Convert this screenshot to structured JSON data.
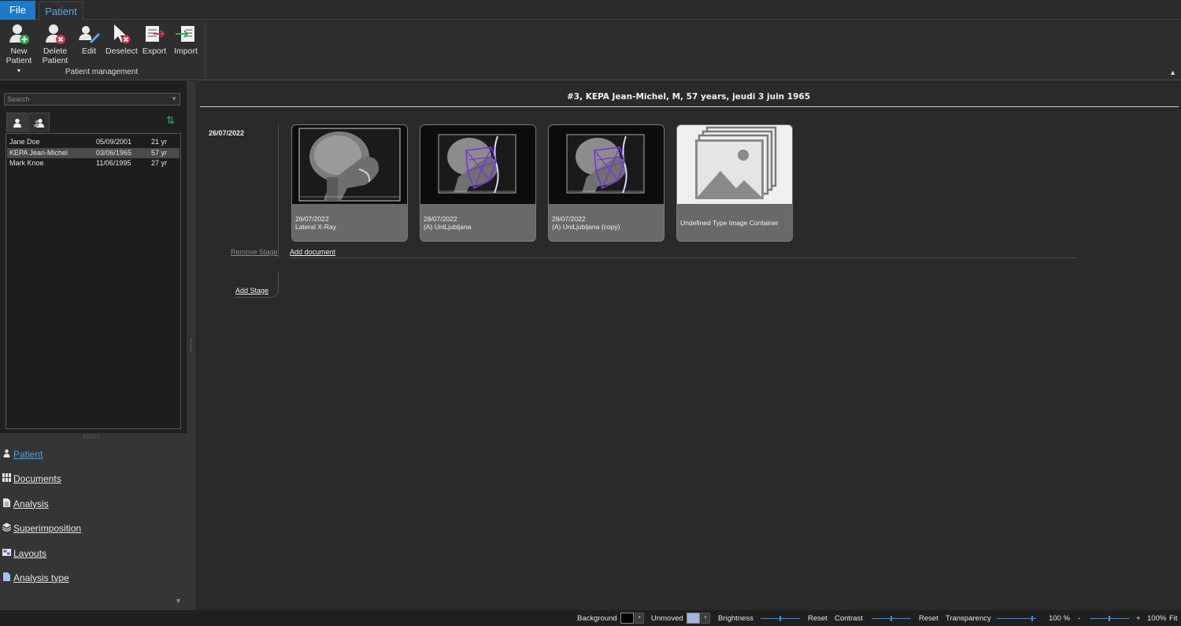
{
  "ribbon": {
    "tabs": [
      {
        "label": "File"
      },
      {
        "label": "Patient"
      }
    ],
    "buttons": {
      "new_patient": [
        "New",
        "Patient"
      ],
      "delete_patient": [
        "Delete",
        "Patient"
      ],
      "edit": "Edit",
      "deselect": "Deselect",
      "export": "Export",
      "import": "Import"
    },
    "group_label": "Patient management"
  },
  "left_panel": {
    "search_placeholder": "Search",
    "patients": [
      {
        "name": "Jane Doe",
        "birthdate": "05/09/2001",
        "age": "21 yr",
        "selected": false
      },
      {
        "name": "KEPA Jean-Michel",
        "birthdate": "03/06/1965",
        "age": "57 yr",
        "selected": true
      },
      {
        "name": "Mark Knoe",
        "birthdate": "11/06/1995",
        "age": "27 yr",
        "selected": false
      }
    ],
    "nav": [
      {
        "label": "Patient",
        "icon": "person-icon",
        "active": true
      },
      {
        "label": "Documents",
        "icon": "grid-icon",
        "active": false
      },
      {
        "label": "Analysis",
        "icon": "document-icon",
        "active": false
      },
      {
        "label": "Superimposition",
        "icon": "layers-icon",
        "active": false
      },
      {
        "label": "Layouts",
        "icon": "layout-icon",
        "active": false
      },
      {
        "label": "Analysis type",
        "icon": "page-icon",
        "active": false
      }
    ]
  },
  "main": {
    "patient_header": "#3,   KEPA Jean-Michel,   M,   57 years,   jeudi 3 juin 1965",
    "stage_date": "26/07/2022",
    "documents": [
      {
        "date": "26/07/2022",
        "title": "Lateral X-Ray",
        "kind": "xray"
      },
      {
        "date": "28/07/2022",
        "title": "(A) UniLjubljana",
        "kind": "analysis"
      },
      {
        "date": "28/07/2022",
        "title": "(A) UniLjubljana (copy)",
        "kind": "analysis"
      },
      {
        "date": "",
        "title": "Undefined Type Image Container",
        "kind": "placeholder"
      }
    ],
    "remove_stage": "Remove Stage",
    "add_document": "Add document",
    "add_stage": "Add Stage"
  },
  "statusbar": {
    "background_label": "Background",
    "background_color": "#000000",
    "unmoved_label": "Unmoved",
    "unmoved_color": "#9fb6e0",
    "brightness_label": "Brightness",
    "reset1": "Reset",
    "contrast_label": "Contrast",
    "reset2": "Reset",
    "transparency_label": "Transparency",
    "transparency_value": "100 %",
    "minus": "-",
    "plus": "+",
    "zoom_value": "100%",
    "fit": "Fit"
  },
  "colors": {
    "accent": "#1e79c8",
    "link_blue": "#4a9fe8",
    "analysis_overlay": "#7a2ee0"
  }
}
